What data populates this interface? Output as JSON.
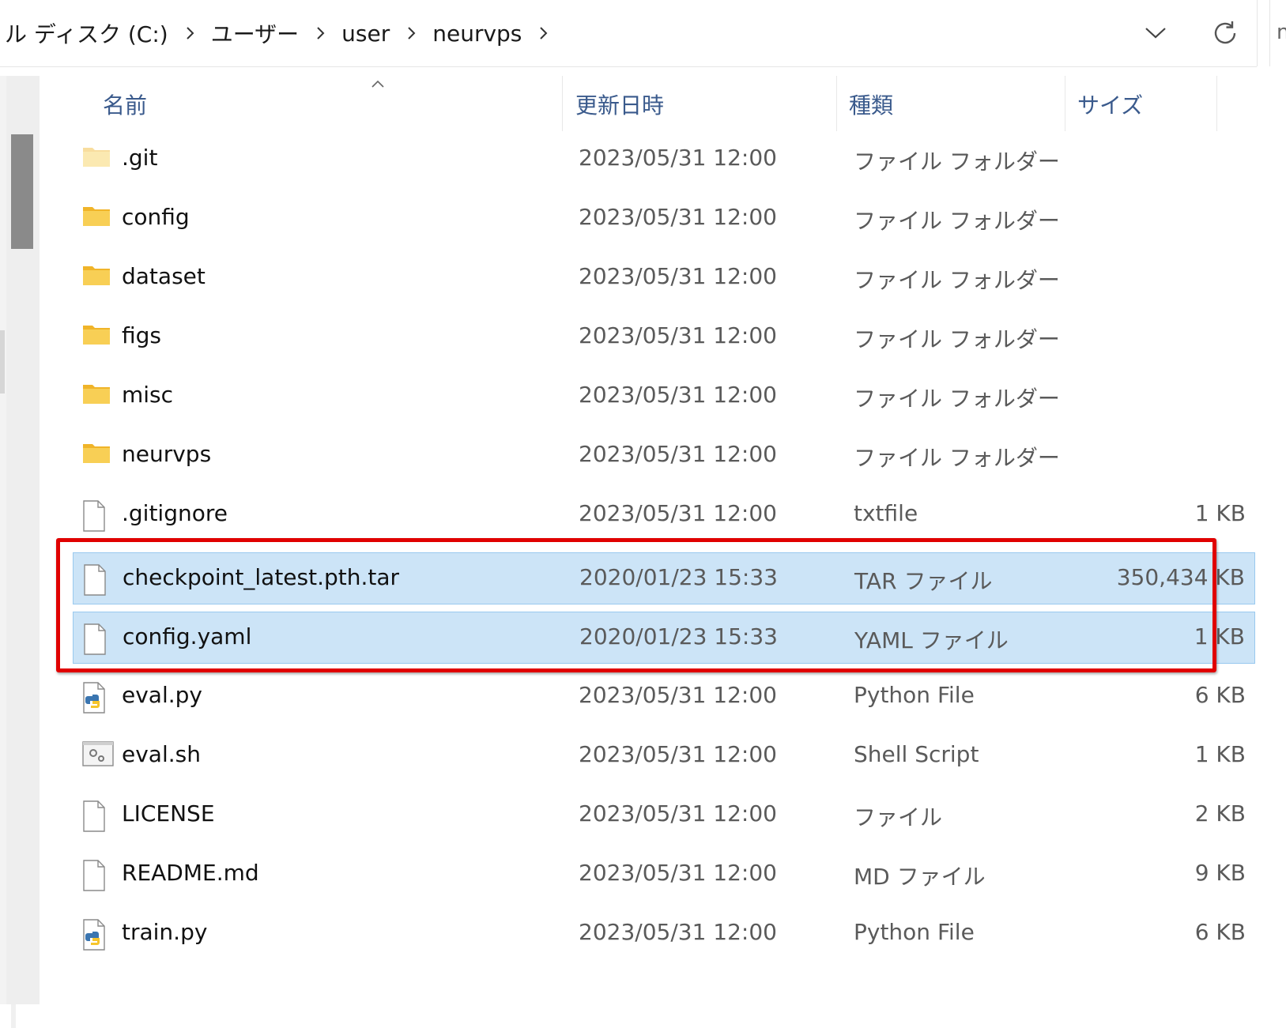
{
  "addressbar": {
    "breadcrumbs": [
      "ル ディスク (C:)",
      "ユーザー",
      "user",
      "neurvps"
    ],
    "search_stub": "n"
  },
  "columns": {
    "name": "名前",
    "date": "更新日時",
    "type": "種類",
    "size": "サイズ"
  },
  "files": [
    {
      "name": ".git",
      "date": "2023/05/31 12:00",
      "type": "ファイル フォルダー",
      "size": "",
      "icon": "folder-icon-faded"
    },
    {
      "name": "config",
      "date": "2023/05/31 12:00",
      "type": "ファイル フォルダー",
      "size": "",
      "icon": "folder-icon"
    },
    {
      "name": "dataset",
      "date": "2023/05/31 12:00",
      "type": "ファイル フォルダー",
      "size": "",
      "icon": "folder-icon"
    },
    {
      "name": "figs",
      "date": "2023/05/31 12:00",
      "type": "ファイル フォルダー",
      "size": "",
      "icon": "folder-icon"
    },
    {
      "name": "misc",
      "date": "2023/05/31 12:00",
      "type": "ファイル フォルダー",
      "size": "",
      "icon": "folder-icon"
    },
    {
      "name": "neurvps",
      "date": "2023/05/31 12:00",
      "type": "ファイル フォルダー",
      "size": "",
      "icon": "folder-icon"
    },
    {
      "name": ".gitignore",
      "date": "2023/05/31 12:00",
      "type": "txtfile",
      "size": "1 KB",
      "icon": "file-icon"
    },
    {
      "name": "checkpoint_latest.pth.tar",
      "date": "2020/01/23 15:33",
      "type": "TAR ファイル",
      "size": "350,434 KB",
      "icon": "file-icon",
      "selected": true
    },
    {
      "name": "config.yaml",
      "date": "2020/01/23 15:33",
      "type": "YAML ファイル",
      "size": "1 KB",
      "icon": "file-icon",
      "selected": true
    },
    {
      "name": "eval.py",
      "date": "2023/05/31 12:00",
      "type": "Python File",
      "size": "6 KB",
      "icon": "python-file-icon"
    },
    {
      "name": "eval.sh",
      "date": "2023/05/31 12:00",
      "type": "Shell Script",
      "size": "1 KB",
      "icon": "shell-script-icon"
    },
    {
      "name": "LICENSE",
      "date": "2023/05/31 12:00",
      "type": "ファイル",
      "size": "2 KB",
      "icon": "file-icon"
    },
    {
      "name": "README.md",
      "date": "2023/05/31 12:00",
      "type": "MD ファイル",
      "size": "9 KB",
      "icon": "file-icon"
    },
    {
      "name": "train.py",
      "date": "2023/05/31 12:00",
      "type": "Python File",
      "size": "6 KB",
      "icon": "python-file-icon"
    }
  ],
  "colors": {
    "selection": "#cce4f7",
    "highlight_box": "#e00000",
    "header_text": "#3a5a8c",
    "folder": "#f8c83a"
  }
}
